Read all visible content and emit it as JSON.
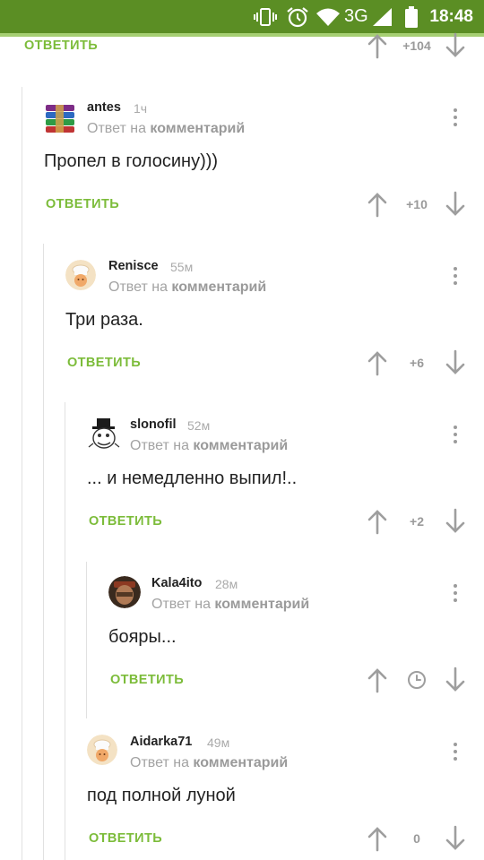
{
  "status_bar": {
    "network": "3G",
    "time": "18:48"
  },
  "top_row": {
    "reply_label": "ОТВЕТИТЬ",
    "score": "+104"
  },
  "comments": [
    {
      "username": "antes",
      "time": "1ч",
      "reply_prefix": "Ответ на",
      "reply_link": "комментарий",
      "text": "Пропел в голосину)))",
      "reply_label": "ОТВЕТИТЬ",
      "score": "+10"
    },
    {
      "username": "Renisce",
      "time": "55м",
      "reply_prefix": "Ответ на",
      "reply_link": "комментарий",
      "text": "Три раза.",
      "reply_label": "ОТВЕТИТЬ",
      "score": "+6"
    },
    {
      "username": "slonofil",
      "time": "52м",
      "reply_prefix": "Ответ на",
      "reply_link": "комментарий",
      "text": "... и немедленно выпил!..",
      "reply_label": "ОТВЕТИТЬ",
      "score": "+2"
    },
    {
      "username": "Kala4ito",
      "time": "28м",
      "reply_prefix": "Ответ на",
      "reply_link": "комментарий",
      "text": "бояры...",
      "reply_label": "ОТВЕТИТЬ",
      "score_icon": "clock-icon"
    },
    {
      "username": "Aidarka71",
      "time": "49м",
      "reply_prefix": "Ответ на",
      "reply_link": "комментарий",
      "text": "под полной луной",
      "reply_label": "ОТВЕТИТЬ",
      "score": "0"
    }
  ],
  "colors": {
    "status_bar": "#5b8e24",
    "accent_green": "#7cbc3a",
    "thread_line": "#e1e1e1"
  }
}
